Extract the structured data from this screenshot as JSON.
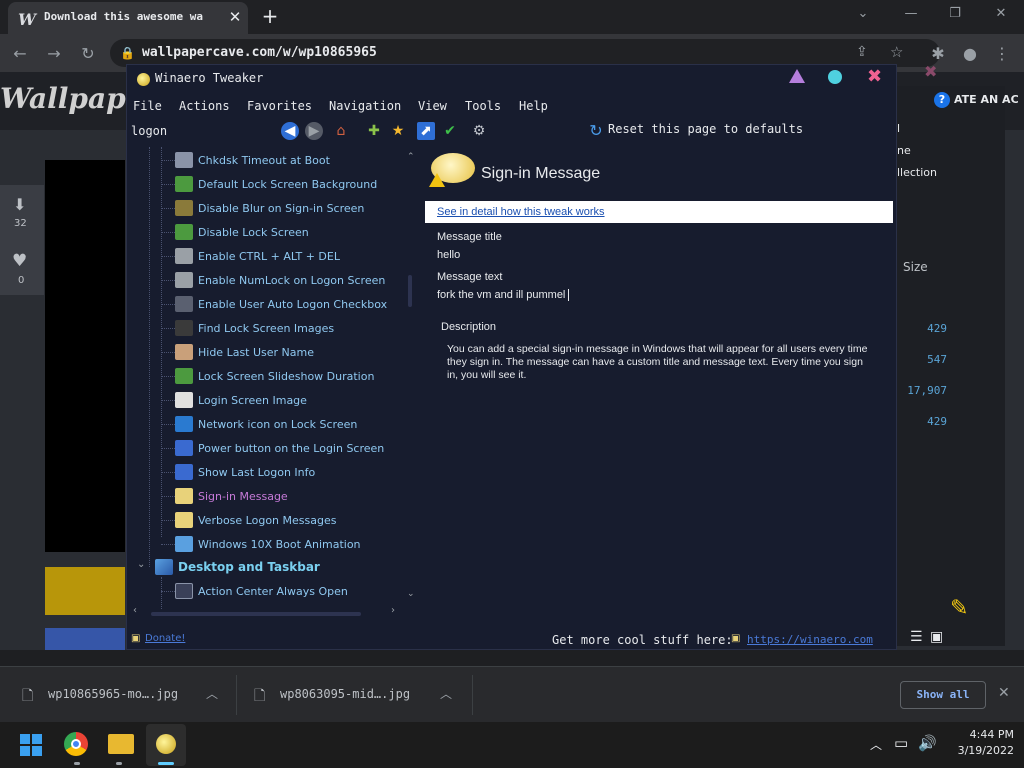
{
  "browser": {
    "tab_title": "Download this awesome wa",
    "tab_icon": "W",
    "url": "wallpapercave.com/w/wp10865965"
  },
  "page": {
    "logo": "WallpaperC",
    "downloads_count": "32",
    "likes_count": "0",
    "right_texts": [
      "l",
      "ne",
      "llection"
    ],
    "header_button": "ATE AN AC",
    "size_header": "Size",
    "sizes": [
      "429",
      "547",
      "17,907",
      "429"
    ]
  },
  "app": {
    "title": "Winaero Tweaker",
    "menu": [
      "File",
      "Actions",
      "Favorites",
      "Navigation",
      "View",
      "Tools",
      "Help"
    ],
    "search": "logon",
    "reset_label": "Reset this page to defaults",
    "tree": [
      {
        "label": "Chkdsk Timeout at Boot",
        "color": "#8fc8f0",
        "icon": "#8a93a8"
      },
      {
        "label": "Default Lock Screen Background",
        "color": "#8fc8f0",
        "icon": "#4c9a3f"
      },
      {
        "label": "Disable Blur on Sign-in Screen",
        "color": "#8fc8f0",
        "icon": "#8a7a3a"
      },
      {
        "label": "Disable Lock Screen",
        "color": "#8fc8f0",
        "icon": "#4c9a3f"
      },
      {
        "label": "Enable CTRL + ALT + DEL",
        "color": "#8fc8f0",
        "icon": "#9aa0a6"
      },
      {
        "label": "Enable NumLock on Logon Screen",
        "color": "#8fc8f0",
        "icon": "#9aa0a6"
      },
      {
        "label": "Enable User Auto Logon Checkbox",
        "color": "#8fc8f0",
        "icon": "#5a6070"
      },
      {
        "label": "Find Lock Screen Images",
        "color": "#8fc8f0",
        "icon": "#3a3a3a"
      },
      {
        "label": "Hide Last User Name",
        "color": "#8fc8f0",
        "icon": "#c9a07a"
      },
      {
        "label": "Lock Screen Slideshow Duration",
        "color": "#8fc8f0",
        "icon": "#4c9a3f"
      },
      {
        "label": "Login Screen Image",
        "color": "#8fc8f0",
        "icon": "#e0e0e0"
      },
      {
        "label": "Network icon on Lock Screen",
        "color": "#8fc8f0",
        "icon": "#2a7ad0"
      },
      {
        "label": "Power button on the Login Screen",
        "color": "#8fc8f0",
        "icon": "#3a6ad0"
      },
      {
        "label": "Show Last Logon Info",
        "color": "#8fc8f0",
        "icon": "#3a6ad0"
      },
      {
        "label": "Sign-in Message",
        "color": "#c67ad8",
        "icon": "#e8d27a"
      },
      {
        "label": "Verbose Logon Messages",
        "color": "#8fc8f0",
        "icon": "#e8d27a"
      },
      {
        "label": "Windows 10X Boot Animation",
        "color": "#8fc8f0",
        "icon": "#5aa0e0"
      }
    ],
    "category": "Desktop and Taskbar",
    "category_child": "Action Center Always Open",
    "content_title": "Sign-in Message",
    "detail_link": "See in detail how this tweak works",
    "msg_title_label": "Message title",
    "msg_title_value": "hello",
    "msg_text_label": "Message text",
    "msg_text_value": "fork the vm and ill pummel",
    "description_label": "Description",
    "description": "You can add a special sign-in message in Windows that will appear for all users every time they sign in. The message can have a custom title and message text. Every time you sign in, you will see it.",
    "status_left": "Donate!",
    "status_text": "Get more cool stuff here:",
    "status_link": "https://winaero.com"
  },
  "downloads": {
    "items": [
      "wp10865965-mo….jpg",
      "wp8063095-mid….jpg"
    ],
    "show_all": "Show all"
  },
  "taskbar": {
    "time": "4:44 PM",
    "date": "3/19/2022"
  },
  "colors": {
    "accent_purple": "#b57edc",
    "accent_cyan": "#4fd1e0",
    "accent_pink": "#f06292",
    "link_blue": "#1a4fb0"
  }
}
